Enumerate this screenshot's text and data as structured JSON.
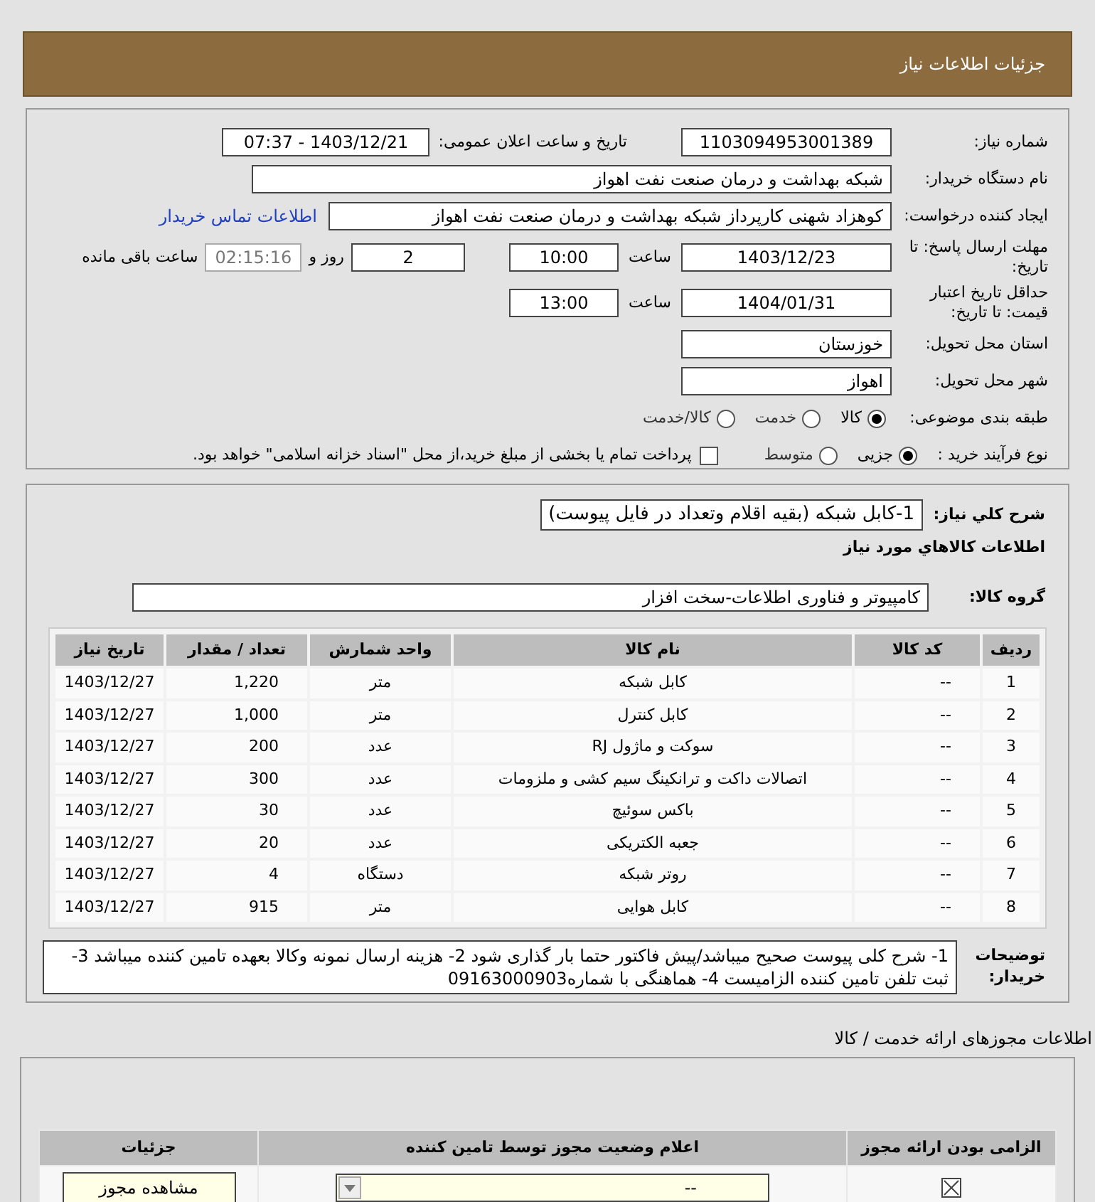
{
  "title": "جزئیات اطلاعات نیاز",
  "need_number": {
    "label": "شماره نیاز:",
    "value": "1103094953001389"
  },
  "announce": {
    "label": "تاریخ و ساعت اعلان عمومی:",
    "value": "1403/12/21 - 07:37"
  },
  "buyer": {
    "label": "نام دستگاه خریدار:",
    "value": "شبکه بهداشت و درمان صنعت نفت اهواز"
  },
  "requester": {
    "label": "ایجاد کننده درخواست:",
    "value": "کوهزاد شهنی کارپرداز شبکه بهداشت و درمان صنعت نفت اهواز",
    "link": "اطلاعات تماس خریدار"
  },
  "deadline": {
    "label": "مهلت ارسال پاسخ: تا تاریخ:",
    "date": "1403/12/23",
    "time_label": "ساعت",
    "time": "10:00",
    "days": "2",
    "days_label": "روز و",
    "remaining": "02:15:16",
    "remaining_label": "ساعت باقی مانده"
  },
  "validity": {
    "label": "حداقل تاریخ اعتبار قیمت: تا تاریخ:",
    "date": "1404/01/31",
    "time_label": "ساعت",
    "time": "13:00"
  },
  "province": {
    "label": "استان محل تحویل:",
    "value": "خوزستان"
  },
  "city": {
    "label": "شهر محل تحویل:",
    "value": "اهواز"
  },
  "category": {
    "label": "طبقه بندی موضوعی:",
    "options": [
      {
        "label": "کالا",
        "selected": true
      },
      {
        "label": "خدمت",
        "selected": false
      },
      {
        "label": "کالا/خدمت",
        "selected": false
      }
    ]
  },
  "process": {
    "label": "نوع فرآیند خرید :",
    "options": [
      {
        "label": "جزیی",
        "selected": true
      },
      {
        "label": "متوسط",
        "selected": false
      }
    ],
    "payment": {
      "label": "پرداخت تمام یا بخشی از مبلغ خرید،از محل \"اسناد خزانه اسلامی\" خواهد بود.",
      "checked": false
    }
  },
  "description": {
    "label": "شرح کلي نياز:",
    "value": "1-کابل شبکه (بقیه اقلام وتعداد در فایل پیوست)"
  },
  "goods_title": "اطلاعات کالاهاي مورد نياز",
  "goods_group": {
    "label": "گروه کالا:",
    "value": "کامپیوتر و فناوری اطلاعات-سخت افزار"
  },
  "table": {
    "columns": [
      "ردیف",
      "کد کالا",
      "نام کالا",
      "واحد شمارش",
      "تعداد / مقدار",
      "تاریخ نیاز"
    ],
    "rows": [
      [
        "1",
        "--",
        "کابل شبکه",
        "متر",
        "1,220",
        "1403/12/27"
      ],
      [
        "2",
        "--",
        "کابل کنترل",
        "متر",
        "1,000",
        "1403/12/27"
      ],
      [
        "3",
        "--",
        "سوکت و ماژول RJ",
        "عدد",
        "200",
        "1403/12/27"
      ],
      [
        "4",
        "--",
        "اتصالات داکت و ترانکینگ سیم کشی و ملزومات",
        "عدد",
        "300",
        "1403/12/27"
      ],
      [
        "5",
        "--",
        "باکس سوئیچ",
        "عدد",
        "30",
        "1403/12/27"
      ],
      [
        "6",
        "--",
        "جعبه الکتریکی",
        "عدد",
        "20",
        "1403/12/27"
      ],
      [
        "7",
        "--",
        "روتر شبکه",
        "دستگاه",
        "4",
        "1403/12/27"
      ],
      [
        "8",
        "--",
        "کابل هوایی",
        "متر",
        "915",
        "1403/12/27"
      ]
    ]
  },
  "notes": {
    "label": "توضیحات خریدار:",
    "value": "1- شرح کلی پیوست صحیح میباشد/پیش فاکتور حتما بار گذاری شود 2- هزینه ارسال نمونه وکالا بعهده تامین کننده میباشد 3-ثبت تلفن تامین کننده الزامیست 4- هماهنگی با شماره09163000903"
  },
  "license_title": "اطلاعات مجوزهای ارائه خدمت / کالا",
  "license_table": {
    "columns": [
      "الزامی بودن ارائه مجوز",
      "اعلام وضعیت مجوز توسط تامین کننده",
      "جزئیات"
    ],
    "rows": [
      {
        "required": true,
        "status": "--",
        "button": "مشاهده مجوز"
      }
    ]
  }
}
